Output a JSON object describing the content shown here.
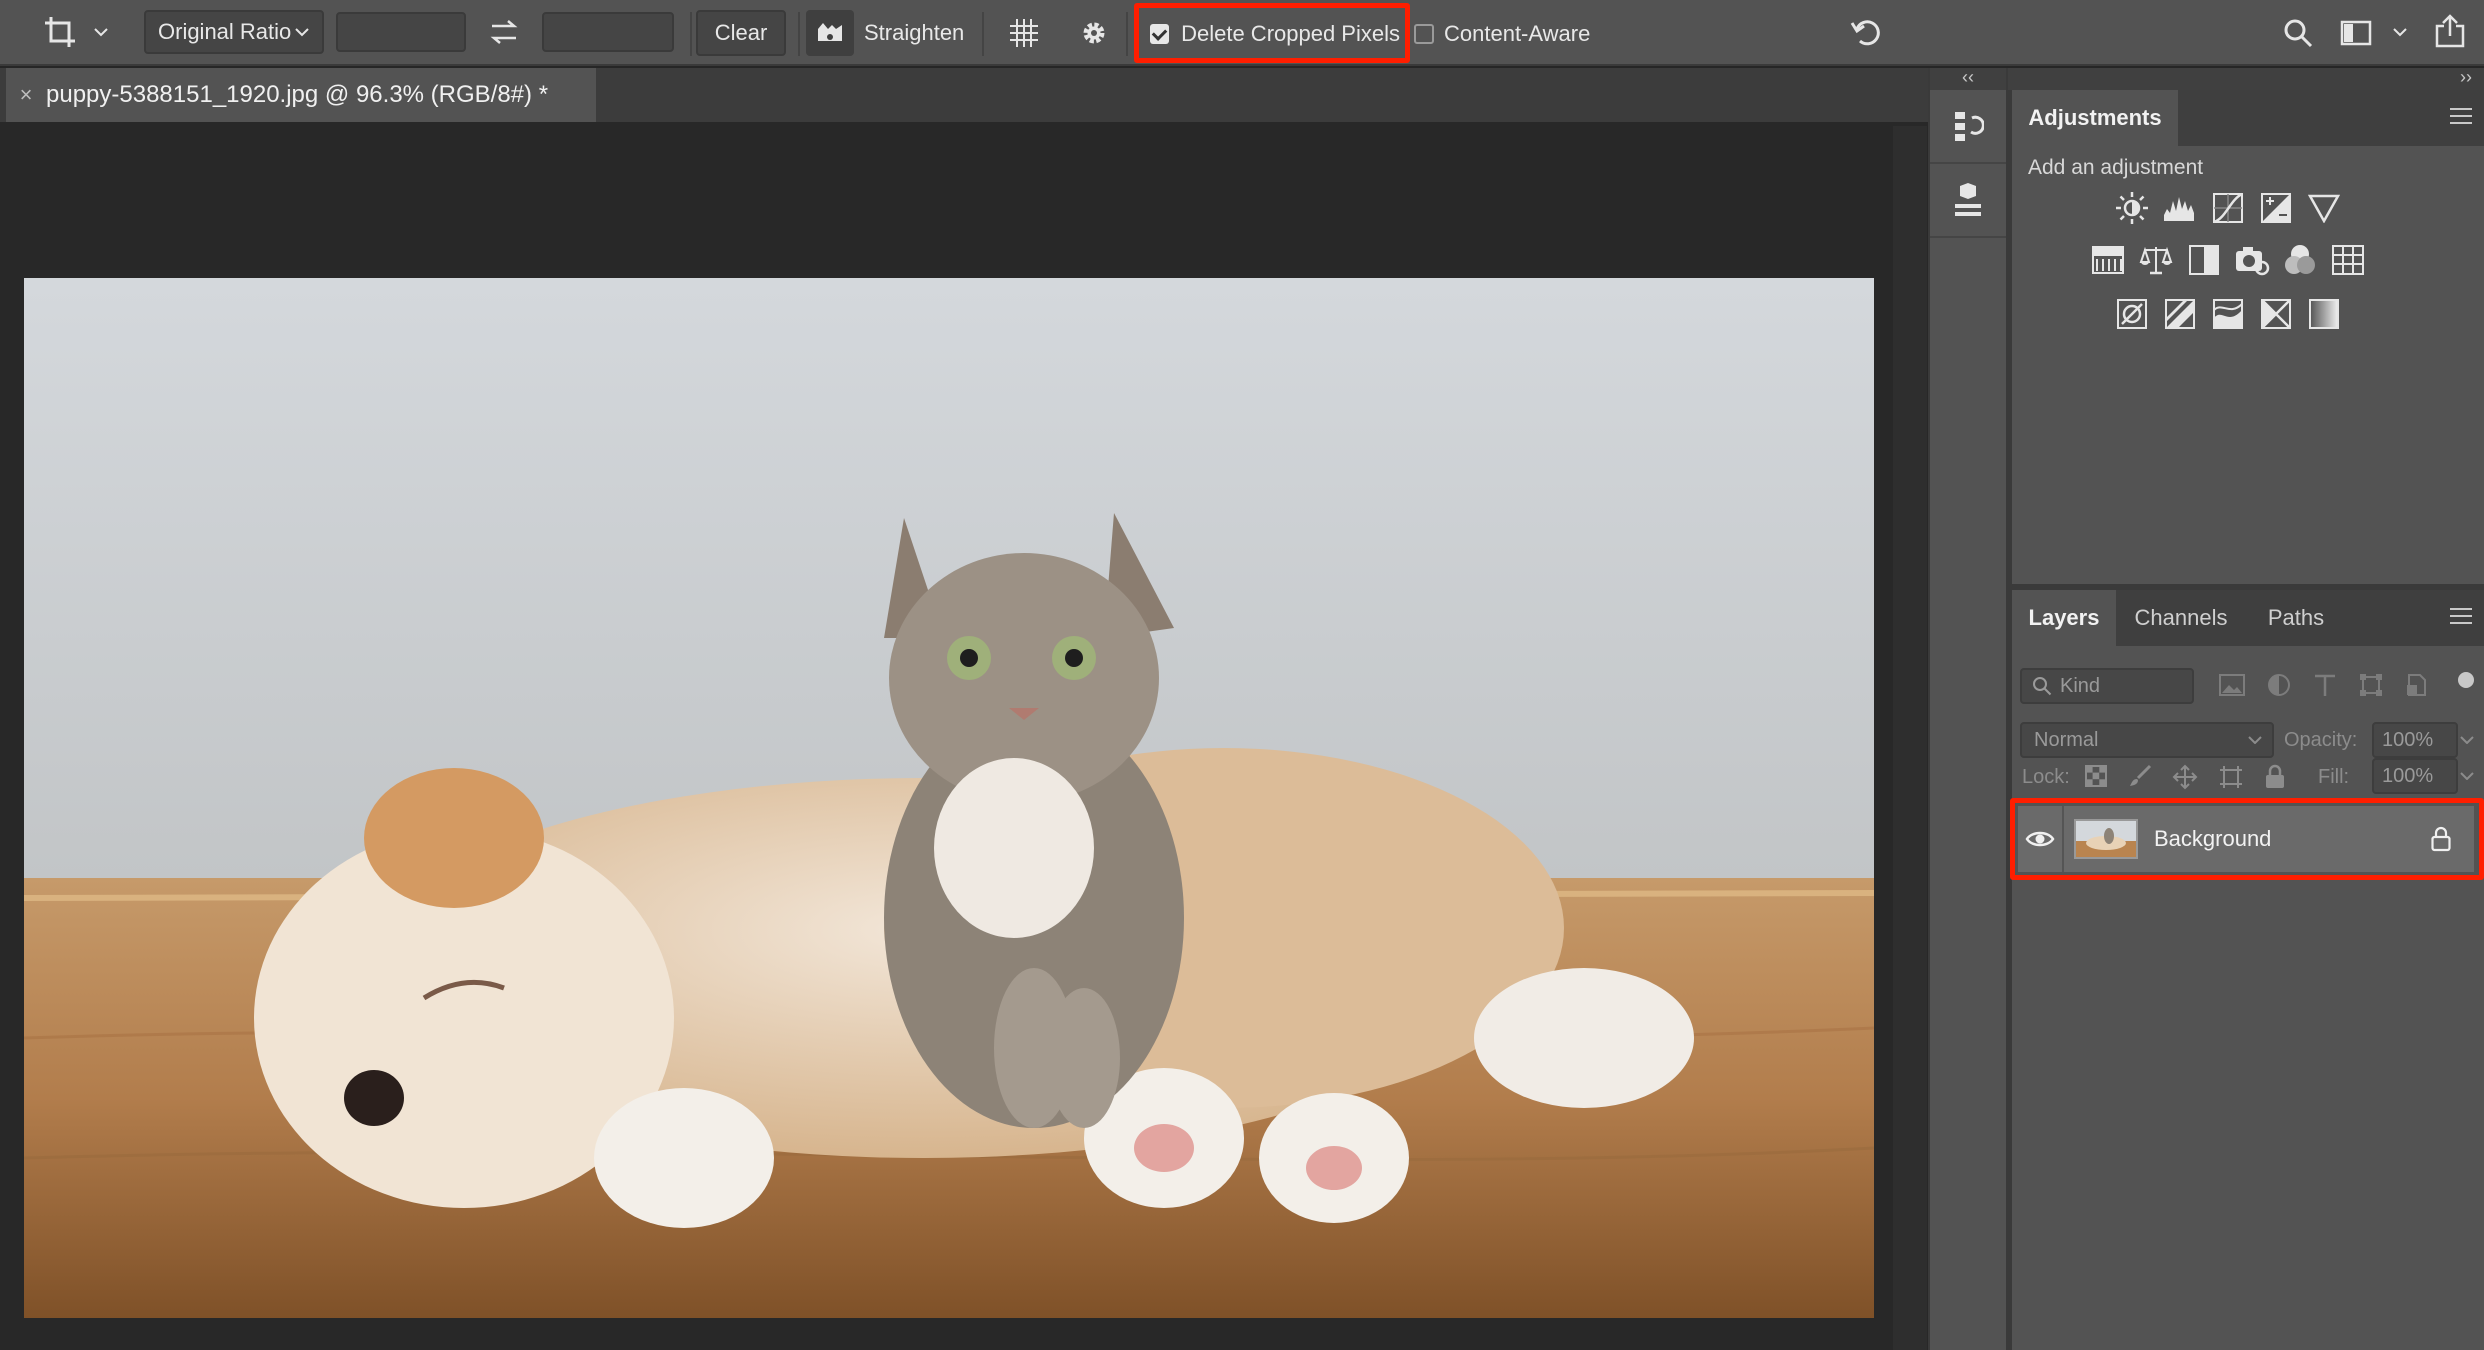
{
  "options_bar": {
    "tool_icon": "crop-icon",
    "ratio_select": "Original Ratio",
    "width_value": "",
    "height_value": "",
    "swap_icon": "swap-arrows-icon",
    "clear_label": "Clear",
    "straighten_icon": "level-icon",
    "straighten_label": "Straighten",
    "overlay_icon": "grid-overlay-icon",
    "settings_icon": "gear-icon",
    "delete_cropped": {
      "label": "Delete Cropped Pixels",
      "checked": true
    },
    "content_aware": {
      "label": "Content-Aware",
      "checked": false
    },
    "reset_icon": "undo-icon",
    "search_icon": "search-icon",
    "workspace_icon": "workspace-icon",
    "share_icon": "share-icon"
  },
  "document": {
    "tab_title": "puppy-5388151_1920.jpg @ 96.3% (RGB/8#) *",
    "close_glyph": "×"
  },
  "collapse": {
    "left": "‹‹",
    "right": "››"
  },
  "adjustments": {
    "tab": "Adjustments",
    "subtitle": "Add an adjustment",
    "rows": [
      [
        "brightness-contrast-icon",
        "levels-icon",
        "curves-icon",
        "exposure-icon",
        "vibrance-icon"
      ],
      [
        "hue-saturation-icon",
        "color-balance-icon",
        "black-white-icon",
        "photo-filter-icon",
        "channel-mixer-icon",
        "color-lookup-icon"
      ],
      [
        "invert-icon",
        "posterize-icon",
        "threshold-icon",
        "selective-color-icon",
        "gradient-map-icon"
      ]
    ]
  },
  "layers": {
    "tabs": [
      "Layers",
      "Channels",
      "Paths"
    ],
    "filter_placeholder": "Kind",
    "blend_mode": "Normal",
    "opacity_label": "Opacity:",
    "opacity_value": "100%",
    "lock_label": "Lock:",
    "fill_label": "Fill:",
    "fill_value": "100%",
    "items": [
      {
        "name": "Background",
        "visible": true,
        "locked": true
      }
    ]
  },
  "colors": {
    "highlight": "#ff1e00",
    "bar": "#535353",
    "panel": "#535353"
  }
}
